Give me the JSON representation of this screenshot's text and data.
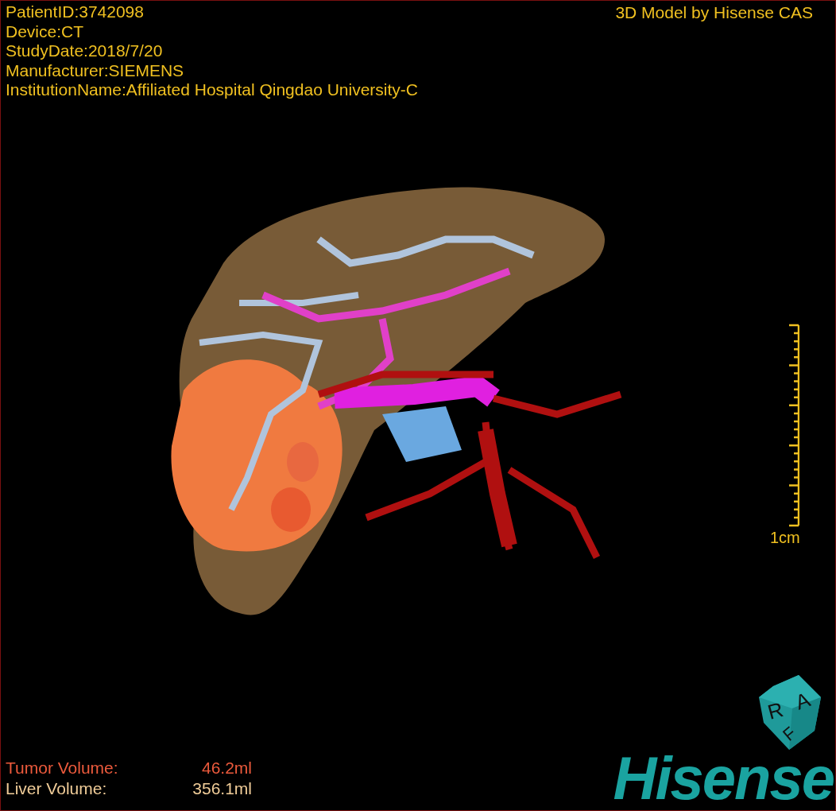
{
  "header": {
    "info_lines": [
      "PatientID:3742098",
      "Device:CT",
      "StudyDate:2018/7/20",
      "Manufacturer:SIEMENS",
      "InstitutionName:Affiliated Hospital Qingdao University-C"
    ],
    "title": "3D Model by Hisense CAS"
  },
  "scale": {
    "label": "1cm"
  },
  "volumes": [
    {
      "kind": "tumor",
      "label": "Tumor Volume:",
      "value": "46.2ml"
    },
    {
      "kind": "liver",
      "label": "Liver Volume:",
      "value": "356.1ml"
    }
  ],
  "orientation_cube": {
    "faces": [
      "R",
      "A",
      "F"
    ]
  },
  "logo": "Hisense"
}
